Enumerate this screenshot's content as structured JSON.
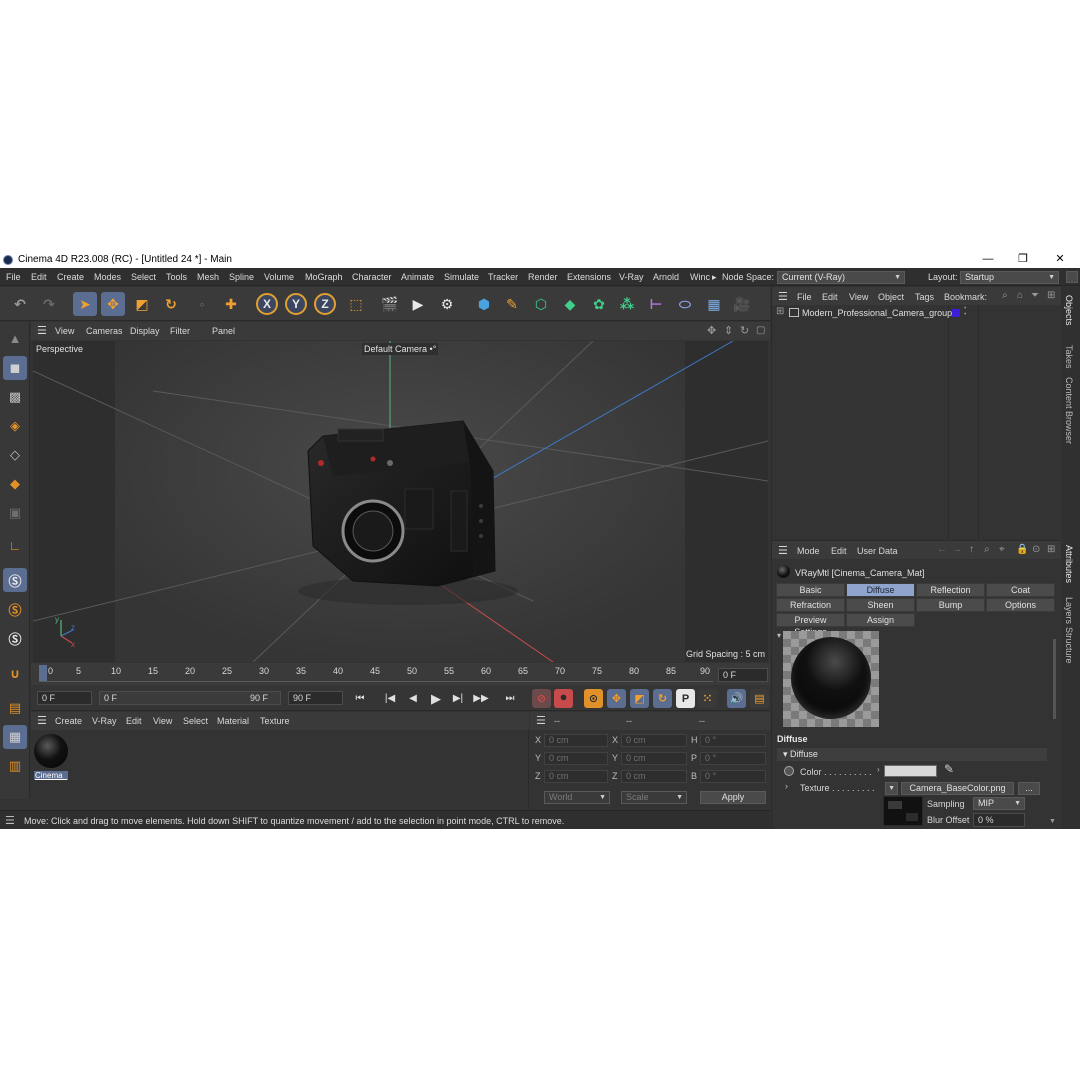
{
  "window": {
    "title": "Cinema 4D R23.008 (RC) - [Untitled 24 *] - Main",
    "controls": {
      "minimize": "—",
      "maximize": "❐",
      "close": "✕"
    }
  },
  "menubar": {
    "items": [
      "File",
      "Edit",
      "Create",
      "Modes",
      "Select",
      "Tools",
      "Mesh",
      "Spline",
      "Volume",
      "MoGraph",
      "Character",
      "Animate",
      "Simulate",
      "Tracker",
      "Render",
      "Extensions",
      "V-Ray",
      "Arnold",
      "Winc",
      "▸"
    ],
    "node_space_label": "Node Space:",
    "node_space_value": "Current (V-Ray)",
    "layout_label": "Layout:",
    "layout_value": "Startup"
  },
  "toolbar": {
    "axis_x": "X",
    "axis_y": "Y",
    "axis_z": "Z"
  },
  "viewport": {
    "menu": [
      "View",
      "Cameras",
      "Display",
      "Filter",
      "Panel"
    ],
    "name": "Perspective",
    "camera": "Default Camera",
    "camera_mark": "•°",
    "grid_spacing": "Grid Spacing : 5 cm",
    "axis_labels": {
      "x": "x",
      "y": "y",
      "z": "z"
    }
  },
  "timeline": {
    "ticks": [
      "0",
      "5",
      "10",
      "15",
      "20",
      "25",
      "30",
      "35",
      "40",
      "45",
      "50",
      "55",
      "60",
      "65",
      "70",
      "75",
      "80",
      "85",
      "90"
    ],
    "current_frame_right": "0 F",
    "start_frame": "0 F",
    "range_start": "0 F",
    "range_end": "90 F",
    "end_frame": "90 F"
  },
  "material_manager": {
    "menu": [
      "Create",
      "V-Ray",
      "Edit",
      "View",
      "Select",
      "Material",
      "Texture"
    ],
    "material_name": "Cinema_"
  },
  "coordinates": {
    "header": [
      "--",
      "--",
      "--"
    ],
    "rows": [
      {
        "a": "X",
        "av": "0 cm",
        "b": "X",
        "bv": "0 cm",
        "c": "H",
        "cv": "0 °"
      },
      {
        "a": "Y",
        "av": "0 cm",
        "b": "Y",
        "bv": "0 cm",
        "c": "P",
        "cv": "0 °"
      },
      {
        "a": "Z",
        "av": "0 cm",
        "b": "Z",
        "bv": "0 cm",
        "c": "B",
        "cv": "0 °"
      }
    ],
    "world": "World",
    "scale": "Scale",
    "apply": "Apply"
  },
  "status": {
    "text": "Move: Click and drag to move elements. Hold down SHIFT to quantize movement / add to the selection in point mode, CTRL to remove."
  },
  "object_manager": {
    "menu": [
      "File",
      "Edit",
      "View",
      "Object",
      "Tags",
      "Bookmark:"
    ],
    "object_name": "Modern_Professional_Camera_group",
    "tag_color": "#3a1fd6"
  },
  "right_tabs": {
    "top": [
      "Objects",
      "Takes",
      "Content Browser"
    ],
    "bottom": [
      "Attributes",
      "Layers",
      "Structure"
    ]
  },
  "attributes": {
    "menu": [
      "Mode",
      "Edit",
      "User Data"
    ],
    "material_title": "VRayMtl [Cinema_Camera_Mat]",
    "tabs_row1": [
      "Basic",
      "Diffuse",
      "Reflection",
      "Coat"
    ],
    "tabs_row2": [
      "Refraction",
      "Sheen",
      "Bump",
      "Options"
    ],
    "tabs_row3": [
      "Preview Settings",
      "Assign"
    ],
    "section": "Diffuse",
    "group": "▾ Diffuse",
    "color_label": "Color . . . . . . . . . .",
    "texture_label": "Texture . . . . . . . . .",
    "texture_file": "Camera_BaseColor.png",
    "more": "...",
    "sampling_label": "Sampling",
    "sampling_value": "MIP",
    "blur_label": "Blur Offset",
    "blur_value": "0 %",
    "accent": "#8fa4cc"
  }
}
